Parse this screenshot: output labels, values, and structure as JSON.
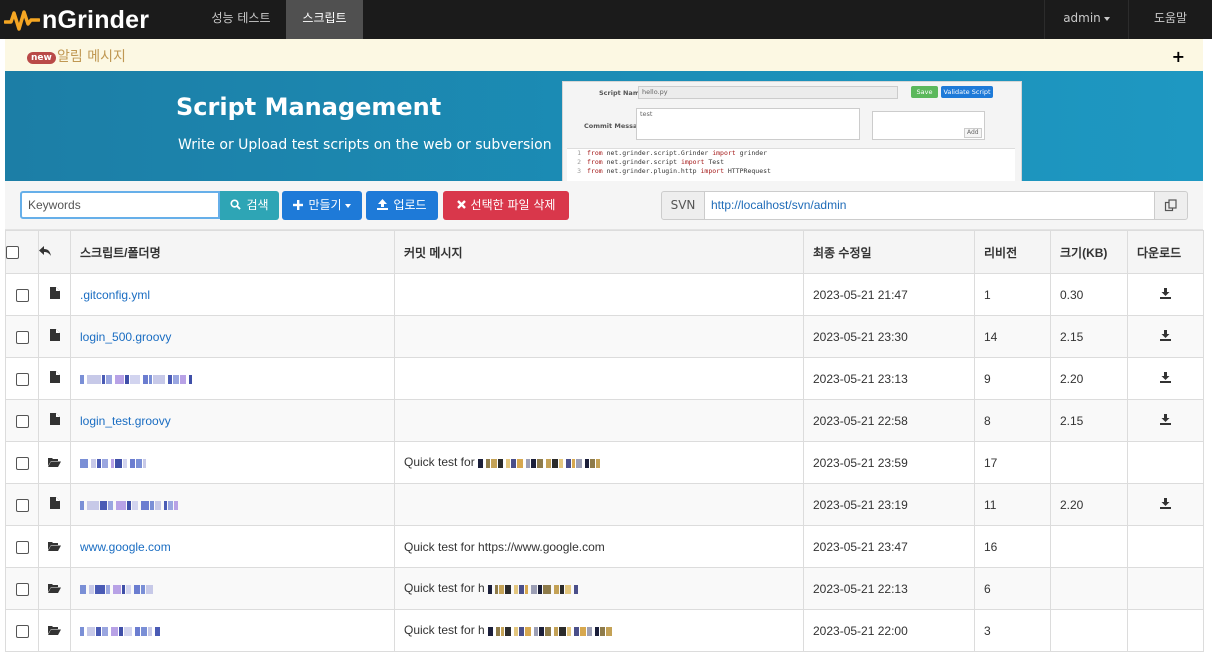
{
  "app": {
    "brand": "nGrinder"
  },
  "nav": {
    "perf_test": "성능 테스트",
    "script": "스크립트",
    "user": "admin",
    "help": "도움말"
  },
  "alert": {
    "badge": "new",
    "text": "알림 메시지",
    "expand": "+"
  },
  "banner": {
    "title": "Script Management",
    "subtitle": "Write or Upload test scripts on the web or subversion",
    "preview": {
      "script_name_label": "Script Name",
      "script_name_value": "hello.py",
      "save_label": "Save",
      "validate_label": "Validate Script",
      "commit_label": "Commit Message",
      "commit_value": "test",
      "add_label": "Add",
      "code": [
        {
          "no": "1",
          "kw1": "from",
          "mod": " net.grinder.script.Grinder ",
          "kw2": "import",
          "name": " grinder"
        },
        {
          "no": "2",
          "kw1": "from",
          "mod": " net.grinder.script ",
          "kw2": "import",
          "name": " Test"
        },
        {
          "no": "3",
          "kw1": "from",
          "mod": " net.grinder.plugin.http ",
          "kw2": "import",
          "name": " HTTPRequest"
        }
      ]
    }
  },
  "toolbar": {
    "search_placeholder": "Keywords",
    "search_label": "검색",
    "make_label": "만들기",
    "upload_label": "업로드",
    "delete_label": "선택한 파일 삭제",
    "svn_label": "SVN",
    "svn_url": "http://localhost/svn/admin"
  },
  "table": {
    "headers": {
      "name": "스크립트/폴더명",
      "commit": "커밋 메시지",
      "modified": "최종 수정일",
      "revision": "리비전",
      "size": "크기(KB)",
      "download": "다운로드"
    },
    "rows": [
      {
        "type": "file",
        "name": ".gitconfig.yml",
        "commit": "",
        "date": "2023-05-21 21:47",
        "rev": "1",
        "size": "0.30",
        "download": true
      },
      {
        "type": "file",
        "name": "login_500.groovy",
        "commit": "",
        "date": "2023-05-21 23:30",
        "rev": "14",
        "size": "2.15",
        "download": true
      },
      {
        "type": "file",
        "name": "",
        "commit": "",
        "date": "2023-05-21 23:13",
        "rev": "9",
        "size": "2.20",
        "download": true
      },
      {
        "type": "file",
        "name": "login_test.groovy",
        "commit": "",
        "date": "2023-05-21 22:58",
        "rev": "8",
        "size": "2.15",
        "download": true
      },
      {
        "type": "folder",
        "name": "",
        "commit": "Quick test for",
        "date": "2023-05-21 23:59",
        "rev": "17",
        "size": "",
        "download": false
      },
      {
        "type": "file",
        "name": "",
        "commit": "",
        "date": "2023-05-21 23:19",
        "rev": "11",
        "size": "2.20",
        "download": true
      },
      {
        "type": "folder",
        "name": "www.google.com",
        "commit": "Quick test for https://www.google.com",
        "date": "2023-05-21 23:47",
        "rev": "16",
        "size": "",
        "download": false
      },
      {
        "type": "folder",
        "name": "",
        "commit": "Quick test for h",
        "date": "2023-05-21 22:13",
        "rev": "6",
        "size": "",
        "download": false
      },
      {
        "type": "folder",
        "name": "",
        "commit": "Quick test for h",
        "date": "2023-05-21 22:00",
        "rev": "3",
        "size": "",
        "download": false
      }
    ]
  },
  "colors": {
    "navbar": "#1b1b1b",
    "brand_orange": "#f5a623",
    "link": "#1a6dc2",
    "primary": "#1e7ad8",
    "info": "#2ea5b5",
    "danger": "#d9374b",
    "banner": "#1b8fb8"
  }
}
